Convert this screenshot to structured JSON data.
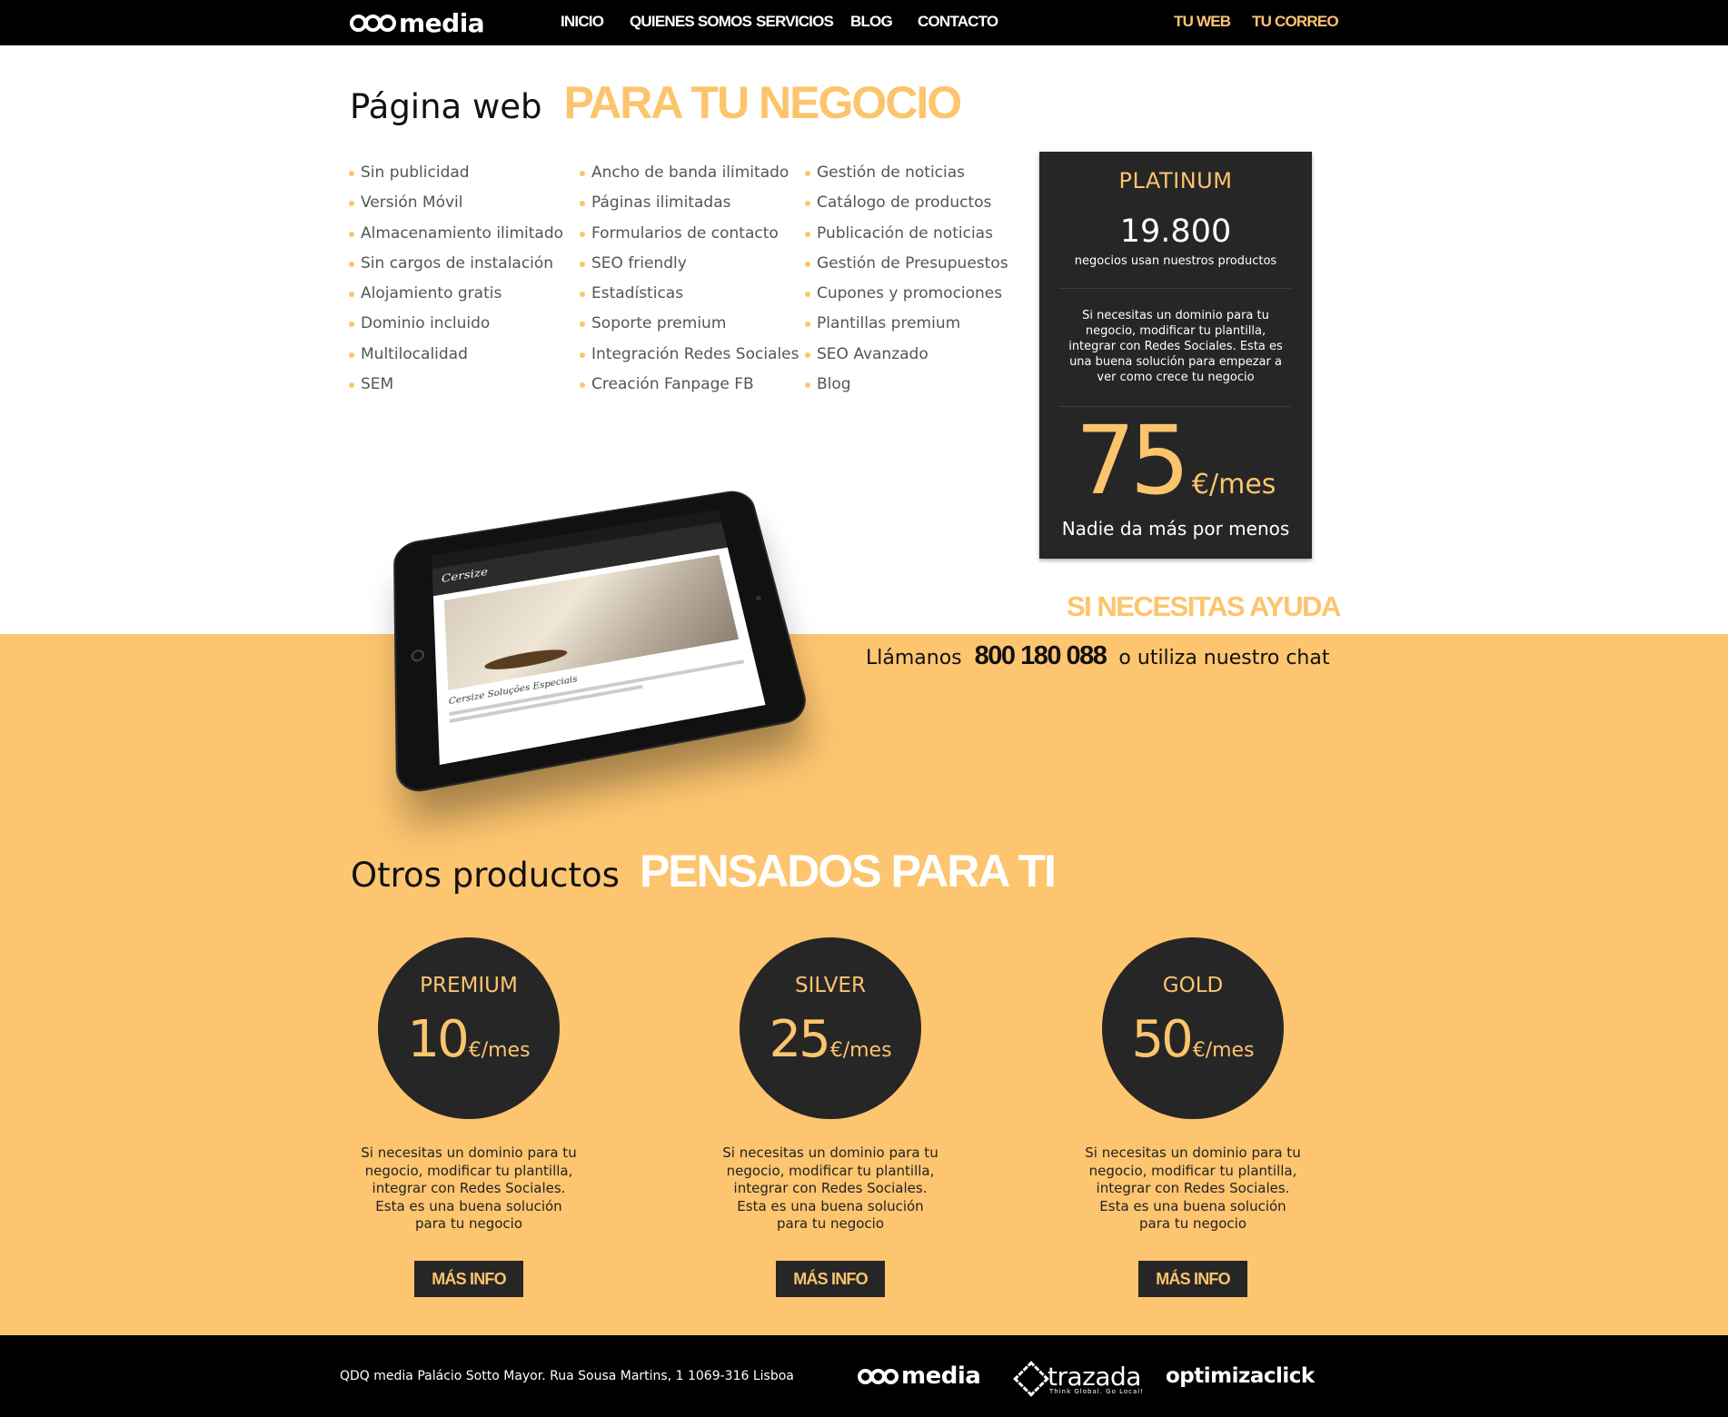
{
  "brand": {
    "name": "media"
  },
  "nav": {
    "items": [
      "INICIO",
      "QUIENES SOMOS",
      "SERVICIOS",
      "BLOG",
      "CONTACTO"
    ],
    "right": [
      "TU WEB",
      "TU CORREO"
    ]
  },
  "hero": {
    "title_light": "Página web",
    "title_bold": "PARA TU NEGOCIO"
  },
  "features": {
    "col1": [
      "Sin publicidad",
      "Versión Móvil",
      "Almacenamiento ilimitado",
      "Sin cargos de instalación",
      "Alojamiento gratis",
      "Dominio incluido",
      "Multilocalidad",
      "SEM"
    ],
    "col2": [
      "Ancho de banda ilimitado",
      "Páginas ilimitadas",
      "Formularios de contacto",
      "SEO friendly",
      "Estadísticas",
      "Soporte premium",
      "Integración Redes Sociales",
      "Creación Fanpage FB"
    ],
    "col3": [
      "Gestión de noticias",
      "Catálogo de productos",
      "Publicación de noticias",
      "Gestión de Presupuestos",
      "Cupones y promociones",
      "Plantillas premium",
      "SEO Avanzado",
      "Blog"
    ]
  },
  "platinum": {
    "name": "PLATINUM",
    "count": "19.800",
    "count_label": "negocios usan nuestros productos",
    "description": "Si necesitas un dominio para tu negocio, modificar tu plantilla, integrar con Redes Sociales. Esta es una buena solución para empezar a ver como crece tu negocio",
    "price": "75",
    "unit": "€/mes",
    "tagline": "Nadie da más por menos"
  },
  "help": {
    "title": "SI NECESITAS AYUDA",
    "pre": "Llámanos",
    "phone": "800 180 088",
    "post": "o utiliza nuestro chat"
  },
  "tablet": {
    "site_title": "Cersize",
    "caption": "Cersize Soluções Especiais"
  },
  "otros": {
    "title_light": "Otros productos",
    "title_bold": "PENSADOS PARA TI"
  },
  "products": [
    {
      "name": "PREMIUM",
      "price": "10",
      "unit": "€/mes",
      "description": "Si necesitas un dominio para tu negocio, modificar tu plantilla, integrar con Redes Sociales. Esta es una buena solución para tu negocio",
      "button": "MÁS INFO"
    },
    {
      "name": "SILVER",
      "price": "25",
      "unit": "€/mes",
      "description": "Si necesitas un dominio para tu negocio, modificar tu plantilla, integrar con Redes Sociales. Esta es una buena solución para tu negocio",
      "button": "MÁS INFO"
    },
    {
      "name": "GOLD",
      "price": "50",
      "unit": "€/mes",
      "description": "Si necesitas un dominio para tu negocio, modificar tu plantilla, integrar con Redes Sociales. Esta es una buena solución para tu negocio",
      "button": "MÁS INFO"
    }
  ],
  "footer": {
    "address": "QDQ media Palácio Sotto Mayor. Rua Sousa Martins, 1 1069-316 Lisboa",
    "logos": {
      "qdq": "media",
      "trazada": "trazada",
      "trazada_sub": "Think Global. Go Local!",
      "optimiza": "optimizaclick"
    }
  },
  "colors": {
    "accent": "#fcc46c",
    "band": "#fdc56f",
    "dark": "#262626",
    "bar": "#000000"
  }
}
